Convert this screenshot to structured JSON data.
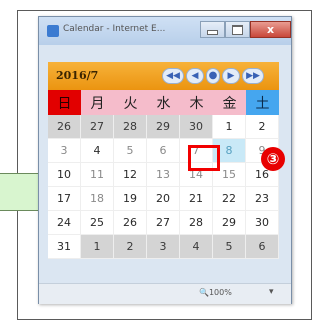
{
  "window": {
    "title": "Calendar - Internet E...",
    "close_label": "x"
  },
  "calendar": {
    "month_label": "2016/7",
    "nav": {
      "prev_year": "◀◀",
      "prev_month": "◀",
      "today": "●",
      "next_month": "▶",
      "next_year": "▶▶"
    },
    "weekdays": [
      "日",
      "月",
      "火",
      "水",
      "木",
      "金",
      "土"
    ],
    "weeks": [
      [
        "26",
        "27",
        "28",
        "29",
        "30",
        "1",
        "2"
      ],
      [
        "3",
        "4",
        "5",
        "6",
        "7",
        "8",
        "9"
      ],
      [
        "10",
        "11",
        "12",
        "13",
        "14",
        "15",
        "16"
      ],
      [
        "17",
        "18",
        "19",
        "20",
        "21",
        "22",
        "23"
      ],
      [
        "24",
        "25",
        "26",
        "27",
        "28",
        "29",
        "30"
      ],
      [
        "31",
        "1",
        "2",
        "3",
        "4",
        "5",
        "6"
      ]
    ],
    "selected_date": "8"
  },
  "annotation": {
    "step_marker": "③"
  },
  "statusbar": {
    "zoom": "100%",
    "zoom_caret": "▾"
  },
  "colors": {
    "header": "#eb9410",
    "sunday": "#e20000",
    "saturday": "#45a6ef",
    "weekday_bg": "#f5bccb",
    "highlight": "#f20000"
  }
}
